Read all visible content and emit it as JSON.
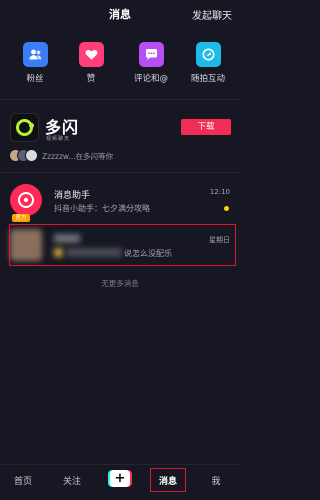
{
  "header": {
    "title": "消息",
    "action": "发起聊天"
  },
  "quick_actions": [
    {
      "label": "粉丝",
      "icon": "fans-icon",
      "color": "#3a7df7"
    },
    {
      "label": "赞",
      "icon": "heart-icon",
      "color": "#ff3e7a"
    },
    {
      "label": "评论和@",
      "icon": "comment-icon",
      "color": "#b74ff5"
    },
    {
      "label": "随拍互动",
      "icon": "camera-interact-icon",
      "color": "#1ebbe8"
    }
  ],
  "promo": {
    "name": "多闪",
    "subtitle": "视频聊天",
    "button": "下载",
    "waiting_text": "Zzzzzw...在多闪等你"
  },
  "conversations": [
    {
      "name": "消息助手",
      "message": "抖音小助手：七夕满分攻略",
      "time": "12:10",
      "badge": "官方",
      "unread": true
    },
    {
      "name": "",
      "message": "说怎么没配乐",
      "time": "星期日",
      "blurred": true
    }
  ],
  "no_more": "无更多消息",
  "tabbar": {
    "items": [
      "首页",
      "关注",
      "消息",
      "我"
    ],
    "active": "消息",
    "plus": "+"
  },
  "colors": {
    "accent": "#f12c55",
    "background": "#161722",
    "highlight": "#e0142c"
  }
}
